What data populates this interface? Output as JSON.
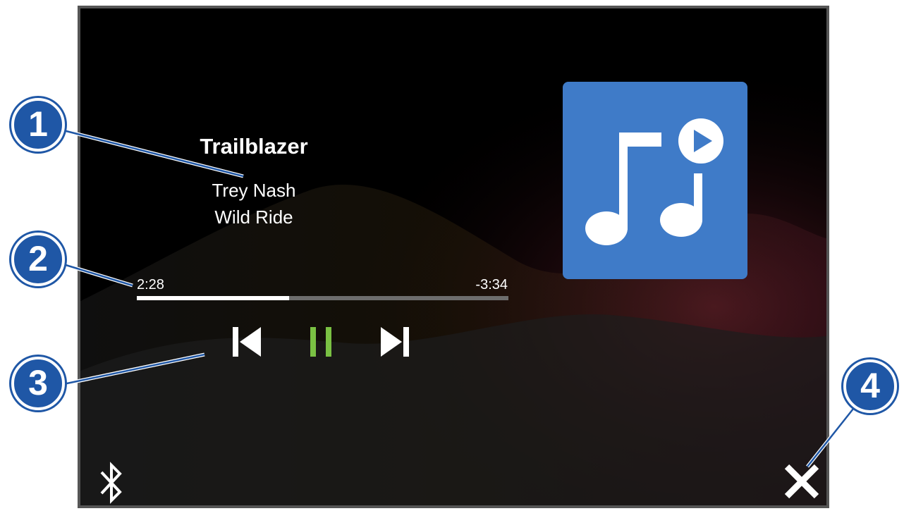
{
  "track": {
    "title": "Trailblazer",
    "artist": "Trey Nash",
    "album": "Wild Ride",
    "elapsed": "2:28",
    "remaining": "-3:34",
    "progress": 0.41
  },
  "controls": {
    "previous_icon": "skip-previous-icon",
    "pause_icon": "pause-icon",
    "next_icon": "skip-next-icon",
    "pause_color": "#7ac143"
  },
  "album_art": {
    "icon": "music-notes-play-icon",
    "color": "#3f7bc8"
  },
  "footer": {
    "bluetooth_icon": "bluetooth-icon",
    "close_icon": "close-icon"
  },
  "callouts": [
    "1",
    "2",
    "3",
    "4"
  ]
}
